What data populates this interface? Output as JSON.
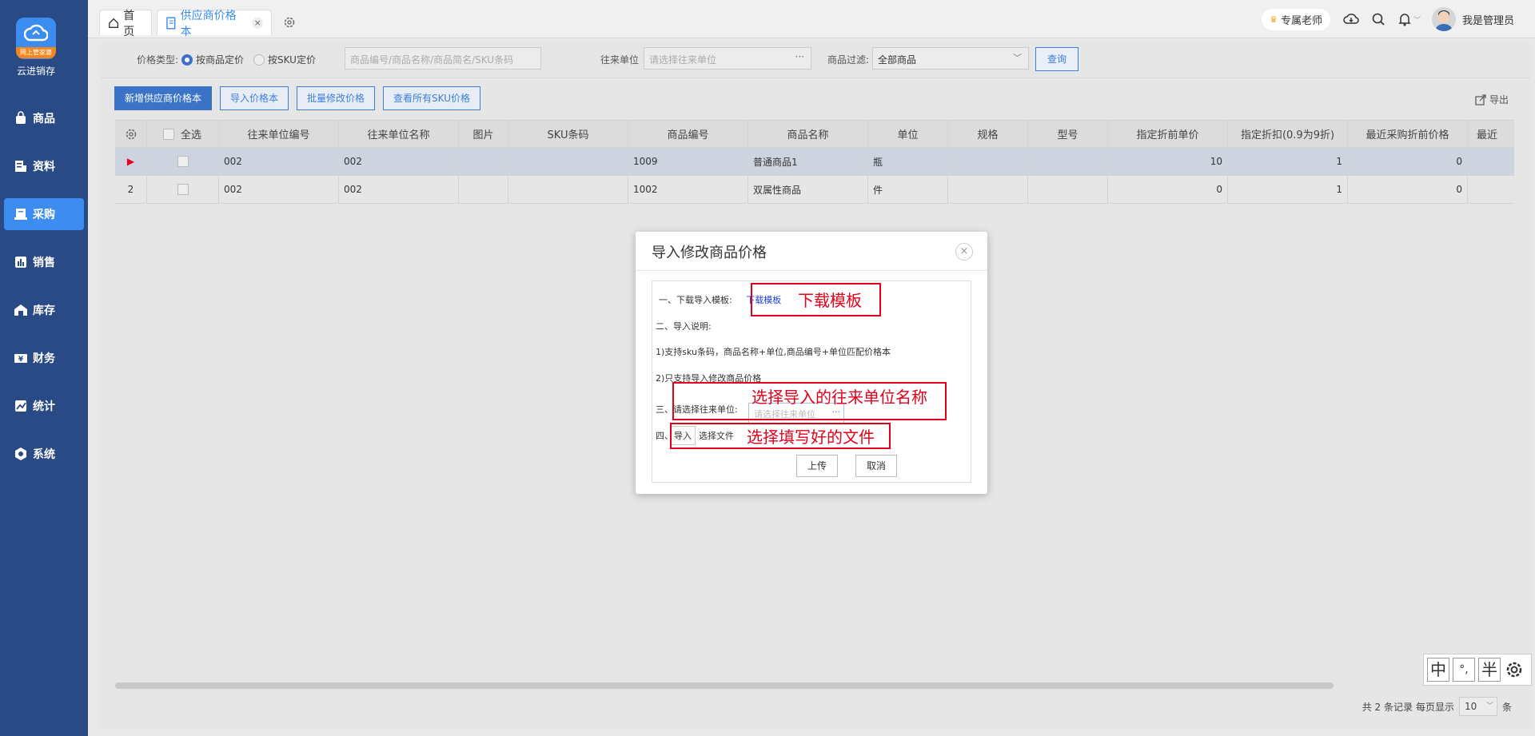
{
  "app": {
    "brand": "云进销存",
    "logo_ribbon": "网上管家婆"
  },
  "sidebar": {
    "items": [
      {
        "label": "商品",
        "icon": "bag-icon"
      },
      {
        "label": "资料",
        "icon": "document-icon"
      },
      {
        "label": "采购",
        "icon": "purchase-icon",
        "active": true
      },
      {
        "label": "销售",
        "icon": "bar-chart-icon"
      },
      {
        "label": "库存",
        "icon": "warehouse-icon"
      },
      {
        "label": "财务",
        "icon": "finance-icon"
      },
      {
        "label": "统计",
        "icon": "trend-icon"
      },
      {
        "label": "系统",
        "icon": "settings-icon"
      }
    ]
  },
  "tabs": {
    "home": "首页",
    "current": "供应商价格本",
    "close": "×"
  },
  "topbar": {
    "teacher": "专属老师",
    "admin": "我是管理员"
  },
  "filters": {
    "price_type_label": "价格类型:",
    "radio_goods": "按商品定价",
    "radio_sku": "按SKU定价",
    "search_placeholder": "商品编号/商品名称/商品简名/SKU条码",
    "unit_label": "往来单位",
    "unit_placeholder": "请选择往来单位",
    "filter_label": "商品过滤:",
    "filter_value": "全部商品",
    "query": "查询"
  },
  "buttons": {
    "add": "新增供应商价格本",
    "import": "导入价格本",
    "batch": "批量修改价格",
    "view_sku": "查看所有SKU价格",
    "export": "导出"
  },
  "table": {
    "select_all": "全选",
    "columns": [
      "往来单位编号",
      "往来单位名称",
      "图片",
      "SKU条码",
      "商品编号",
      "商品名称",
      "单位",
      "规格",
      "型号",
      "指定折前单价",
      "指定折扣(0.9为9折)",
      "最近采购折前价格",
      "最近"
    ],
    "rows": [
      {
        "index": "▶",
        "code": "002",
        "name": "002",
        "goods_no": "1009",
        "goods_name": "普通商品1",
        "unit": "瓶",
        "price": "10",
        "discount": "1",
        "recent": "0"
      },
      {
        "index": "2",
        "code": "002",
        "name": "002",
        "goods_no": "1002",
        "goods_name": "双属性商品",
        "unit": "件",
        "price": "0",
        "discount": "1",
        "recent": "0"
      }
    ]
  },
  "pager": {
    "total": "共 2 条记录",
    "per_page_label": "每页显示",
    "per_page": "10",
    "suffix": "条"
  },
  "modal": {
    "title": "导入修改商品价格",
    "close": "×",
    "step1": "一、下载导入模板:",
    "download_link": "下载模板",
    "step2": "二、导入说明:",
    "note1": "1)支持sku条码，商品名称+单位,商品编号+单位匹配价格本",
    "note2": "2)只支持导入修改商品价格",
    "step3_prefix": "三、",
    "step3": "请选择往来单位:",
    "unit_placeholder": "请选择往来单位",
    "step4": "四、",
    "import_btn": "导入",
    "choose_file": "选择文件",
    "upload": "上传",
    "cancel": "取消"
  },
  "annotations": {
    "download": "下载模板",
    "unit": "选择导入的往来单位名称",
    "file": "选择填写好的文件",
    "color": "#e3001b"
  },
  "ime": {
    "keys": [
      "中",
      "°,",
      "半"
    ]
  }
}
